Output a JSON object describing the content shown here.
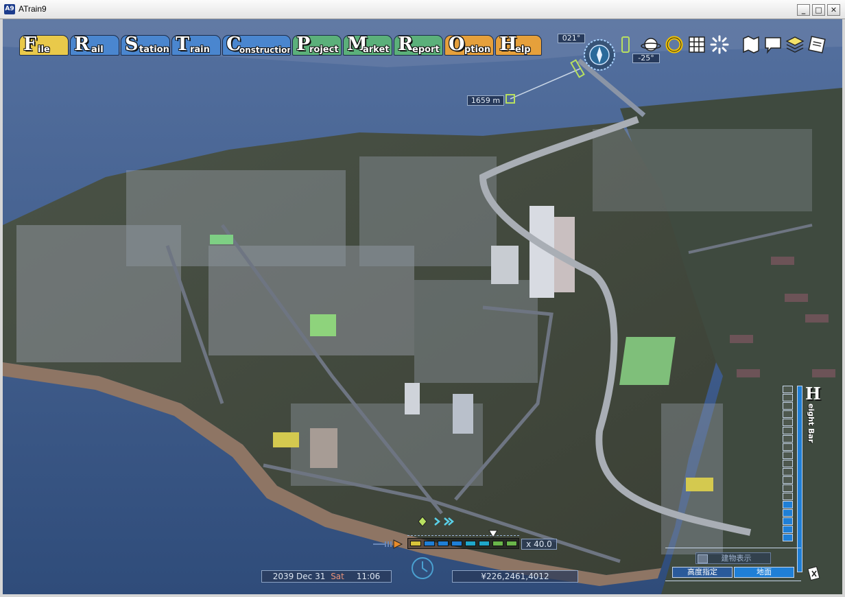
{
  "window": {
    "title": "ATrain9",
    "icon_label": "A9",
    "minimize_glyph": "_",
    "maximize_glyph": "□",
    "close_glyph": "✕"
  },
  "menu": [
    {
      "cap": "F",
      "rest": "ile",
      "color": "#e9c94a"
    },
    {
      "cap": "R",
      "rest": "ail",
      "color": "#4a86cf"
    },
    {
      "cap": "S",
      "rest": "tation",
      "color": "#4a86cf"
    },
    {
      "cap": "T",
      "rest": "rain",
      "color": "#4a86cf"
    },
    {
      "cap": "C",
      "rest": "onstruction",
      "color": "#4a86cf"
    },
    {
      "cap": "P",
      "rest": "roject",
      "color": "#5bb07a"
    },
    {
      "cap": "M",
      "rest": "arket",
      "color": "#5bb07a"
    },
    {
      "cap": "R",
      "rest": "eport",
      "color": "#5bb07a"
    },
    {
      "cap": "O",
      "rest": "ption",
      "color": "#e6a03b"
    },
    {
      "cap": "H",
      "rest": "elp",
      "color": "#e6a03b"
    }
  ],
  "camera": {
    "heading": "021°",
    "pitch": "-25°",
    "distance": "1659 m"
  },
  "toolbar_icons": [
    "planet-icon",
    "rotate-icon",
    "grid-icon",
    "burst-icon",
    "map-icon",
    "speech-bubble-icon",
    "layers-icon",
    "memo-icon"
  ],
  "hud": {
    "date": "2039 Dec 31",
    "weekday": "Sat",
    "time": "11:06",
    "money": "¥226,2461,4012",
    "speed": "x 40.0",
    "building_display": "建物表示",
    "height_specify": "高度指定",
    "ground": "地面",
    "height_bar_label": "eight Bar",
    "height_bar_cap": "H",
    "height_bar_level": 5,
    "height_bar_total": 19
  },
  "colors": {
    "accent_blue": "#1f7fd6",
    "speed_yellow": "#d8c33a",
    "speed_cyan": "#1fa7c9",
    "speed_green": "#6ab54a"
  }
}
